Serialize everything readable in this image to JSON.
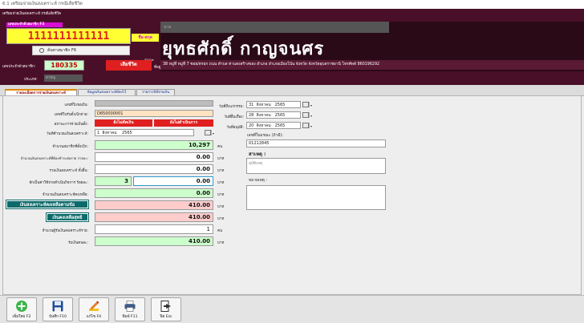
{
  "window": {
    "title": "6.1 เตรียมจ่ายเงินสงเคราะห์ กรณีเสียชีวิต"
  },
  "header": {
    "title": "เตรียมจ่ายเงินสงเคราะห์ กรณีเสียชีวิต",
    "id_caption": "เลขประจำตัวสมาชิก F3",
    "id_number": "1111111111111",
    "name_button": "ชื่อ-สกุล",
    "search_button": "ค้นหาสมาชิก F6",
    "member_no_label": "เลขประจำตัวสมาชิก:",
    "member_no": "180335",
    "age_caption": "สถานะ",
    "status_button": "เสียชีวิต",
    "address_label": "ที่อยู่:",
    "type_label": "ประเภท:",
    "type_value": "สามัญ",
    "name_field": "นาย",
    "member_name": "ยุทธศักดิ์  กาญจนศร",
    "address": "38 หมู่ที่ หมู่ที่ 7 ซอย/ตรอก ถนน ตำบล ท่าแดงสร้างของ อำเภอ อำเภอเมืองโน้น จังหวัด จังหวัดอุบลราชธานี โทรศัพท์ 860196292"
  },
  "tabs": [
    {
      "label": "รายละเอียดการจ่ายเงินสงเคราะห์"
    },
    {
      "label": "ข้อมูลเงินสงเคราะห์ที่คงไว้"
    },
    {
      "label": "รายการปีที่จ่ายเงิน"
    }
  ],
  "form": {
    "doc_no_label": "เลขที่ใบขอเงิน:",
    "receipt_no_label": "เลขที่ใบรับตั้งเบิกจ่าย:",
    "receipt_no": "D650000001",
    "payment_status_label": "สถานะการจ่ายเงินตั้ง:",
    "status_not_paid": "ยังไม่ตัดเงิน",
    "status_not_done": "ยังไม่ดำเนินการ",
    "calc_date_label": "วันที่คำนวณเงินสงเคราะห์:",
    "calc_day": "1",
    "calc_month": "สิงหาคม",
    "calc_year": "2565",
    "dead_members_label": "จำนวนสมาชิกที่ตั้งเบิก:",
    "dead_members": "10,297",
    "dead_members_unit": "คน",
    "per_member_label": "จำนวนเงินสงเคราะห์ที่ต้องชำระต่อราย รายละ:",
    "per_member": "0.00",
    "total_label": "รวมเงินสงเคราะห์ ทั้งสิ้น:",
    "total": "0.00",
    "deduct_label": "หักเป็นค่าใช้จ่ายดำเนินกิจการ ร้อยละ:",
    "deduct_pct": "3",
    "deduct_amount": "0.00",
    "after_deduct_label": "จำนวนเงินสงเคราะห์คงเหลือ:",
    "after_deduct": "0.00",
    "remaining_button": "เงินสงเคราะห์คงเหลือตามข้อ",
    "remaining": "410.00",
    "net_button": "เงินคงเหลือสุทธิ",
    "net": "410.00",
    "heirs_label": "จำนวนผู้รับเงินสงเคราะห์ราย:",
    "heirs": "1",
    "heirs_unit": "คน",
    "per_heir_label": "รับเงินคนละ:",
    "per_heir": "410.00",
    "baht": "บาท"
  },
  "right": {
    "death_date_label": "วันที่ถึงแก่กรรม:",
    "death_day": "31",
    "death_month": "สิงหาคม",
    "death_year": "2565",
    "request_date_label": "วันที่ยื่นเรื่อง:",
    "request_day": "28",
    "request_month": "สิงหาคม",
    "request_year": "2565",
    "approve_date_label": "วันที่อนุมัติ:",
    "approve_day": "20",
    "approve_month": "สิงหาคม",
    "approve_year": "2565",
    "phone_label": "เลขที่ใบมรณะ (ถ้ามี):",
    "phone": "01212845",
    "cause_label": "สาเหตุ :",
    "cause_value": "อุบัติเหตุ",
    "note_label": "หมายเหตุ :"
  },
  "toolbar": {
    "add_label": "เพิ่มใหม่ F2",
    "save_label": "บันทึก F10",
    "edit_label": "แก้ไข F4",
    "print_label": "พิมพ์ F11",
    "exit_label": "ปิด Esc"
  },
  "colors": {
    "header_bg": "#4a0f28",
    "accent_yellow": "#ffff33",
    "status_red": "#e02020",
    "teal": "#0d6a6a"
  },
  "icons": [
    "add-icon",
    "save-icon",
    "edit-icon",
    "print-icon",
    "exit-icon",
    "calendar-icon",
    "chevron-down-icon"
  ]
}
